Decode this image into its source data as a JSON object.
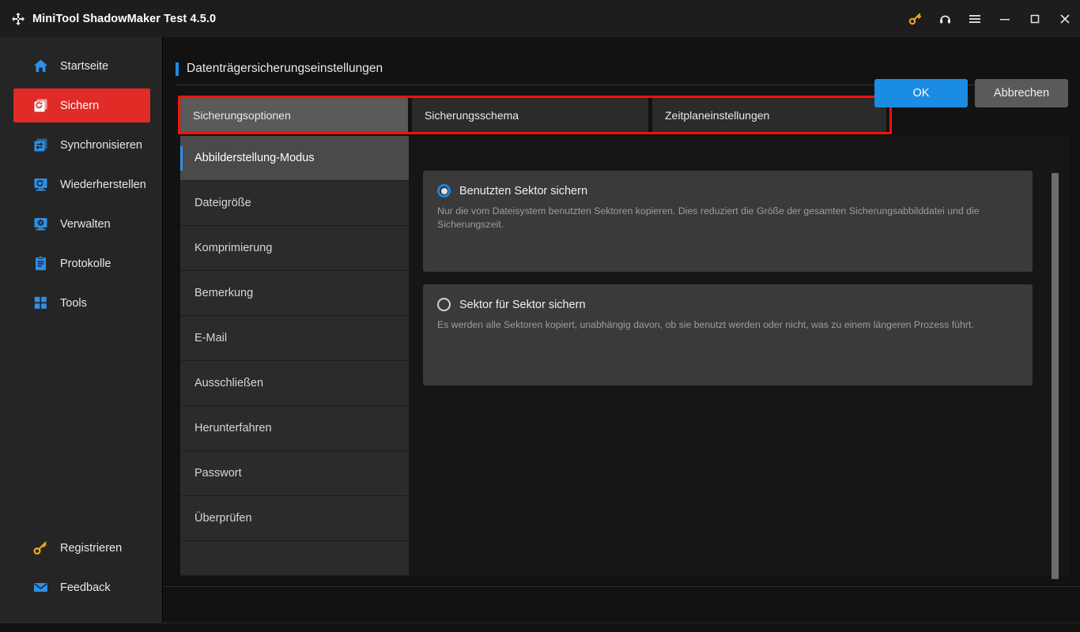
{
  "window": {
    "title": "MiniTool ShadowMaker Test 4.5.0",
    "logo_icon": "shadowmaker-logo-icon",
    "controls": [
      {
        "name": "key-icon",
        "glyph": "⚷",
        "color": "#f0a81e"
      },
      {
        "name": "headphones-icon",
        "glyph": "⌢",
        "color": "#e6e6e6"
      },
      {
        "name": "hamburger-menu-icon",
        "glyph": "☰",
        "color": "#e6e6e6"
      },
      {
        "name": "minimize-icon",
        "glyph": "—",
        "color": "#e6e6e6"
      },
      {
        "name": "maximize-icon",
        "glyph": "□",
        "color": "#e6e6e6"
      },
      {
        "name": "close-icon",
        "glyph": "✕",
        "color": "#e6e6e6"
      }
    ]
  },
  "sidebar": {
    "items": [
      {
        "label": "Startseite",
        "icon": "home-icon",
        "active": false
      },
      {
        "label": "Sichern",
        "icon": "backup-icon",
        "active": true
      },
      {
        "label": "Synchronisieren",
        "icon": "sync-icon",
        "active": false
      },
      {
        "label": "Wiederherstellen",
        "icon": "restore-icon",
        "active": false
      },
      {
        "label": "Verwalten",
        "icon": "manage-icon",
        "active": false
      },
      {
        "label": "Protokolle",
        "icon": "logs-icon",
        "active": false
      },
      {
        "label": "Tools",
        "icon": "tools-icon",
        "active": false
      }
    ],
    "bottom_items": [
      {
        "label": "Registrieren",
        "icon": "key-icon"
      },
      {
        "label": "Feedback",
        "icon": "envelope-icon"
      }
    ],
    "active_color": "#e02b27",
    "icon_color": "#2b90e8"
  },
  "page": {
    "title": "Datenträgersicherungseinstellungen",
    "accent_color": "#1b8ce3"
  },
  "tabs": [
    {
      "label": "Sicherungsoptionen",
      "active": true
    },
    {
      "label": "Sicherungsschema",
      "active": false
    },
    {
      "label": "Zeitplaneinstellungen",
      "active": false
    }
  ],
  "annotation": {
    "name": "red-highlight-box",
    "color": "#fd1008"
  },
  "options_list": [
    {
      "label": "Abbilderstellung-Modus",
      "active": true
    },
    {
      "label": "Dateigröße",
      "active": false
    },
    {
      "label": "Komprimierung",
      "active": false
    },
    {
      "label": "Bemerkung",
      "active": false
    },
    {
      "label": "E-Mail",
      "active": false
    },
    {
      "label": "Ausschließen",
      "active": false
    },
    {
      "label": "Herunterfahren",
      "active": false
    },
    {
      "label": "Passwort",
      "active": false
    },
    {
      "label": "Überprüfen",
      "active": false
    }
  ],
  "image_mode": {
    "choices": [
      {
        "title": "Benutzten Sektor sichern",
        "description": "Nur die vom Dateisystem benutzten Sektoren kopieren. Dies reduziert die Größe der gesamten Sicherungsabbilddatei und die Sicherungszeit.",
        "selected": true
      },
      {
        "title": "Sektor für Sektor sichern",
        "description": "Es werden alle Sektoren kopiert, unabhängig davon, ob sie benutzt werden oder nicht, was zu einem längeren Prozess führt.",
        "selected": false
      }
    ]
  },
  "footer": {
    "ok_label": "OK",
    "cancel_label": "Abbrechen",
    "ok_color": "#1b8ce3"
  }
}
